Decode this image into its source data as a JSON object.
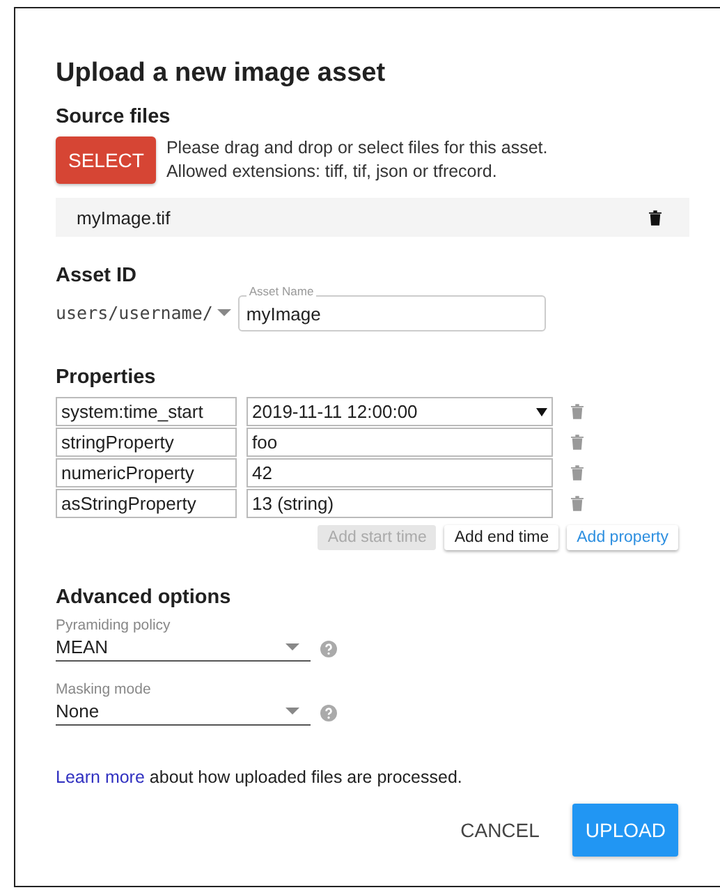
{
  "dialog": {
    "title": "Upload a new image asset"
  },
  "source_files": {
    "heading": "Source files",
    "select_button": "SELECT",
    "hint_lines": [
      "Please drag and drop or select files for this asset.",
      "Allowed extensions: tiff, tif, json or tfrecord."
    ],
    "files": [
      {
        "name": "myImage.tif"
      }
    ]
  },
  "asset_id": {
    "heading": "Asset ID",
    "prefix": "users/username/",
    "name_label": "Asset Name",
    "name_value": "myImage"
  },
  "properties": {
    "heading": "Properties",
    "rows": [
      {
        "key": "system:time_start",
        "value": "2019-11-11 12:00:00",
        "kind": "datetime"
      },
      {
        "key": "stringProperty",
        "value": "foo",
        "kind": "text"
      },
      {
        "key": "numericProperty",
        "value": "42",
        "kind": "text"
      },
      {
        "key": "asStringProperty",
        "value": "13 (string)",
        "kind": "text"
      }
    ],
    "buttons": [
      {
        "label": "Add start time",
        "disabled": true,
        "kind": "plain"
      },
      {
        "label": "Add end time",
        "disabled": false,
        "kind": "plain"
      },
      {
        "label": "Add property",
        "disabled": false,
        "kind": "accent"
      }
    ]
  },
  "advanced": {
    "heading": "Advanced options",
    "selects": [
      {
        "label": "Pyramiding policy",
        "value": "MEAN"
      },
      {
        "label": "Masking mode",
        "value": "None"
      }
    ]
  },
  "footer": {
    "link": "Learn more",
    "text": " about how uploaded files are processed.",
    "buttons": [
      {
        "label": "CANCEL",
        "kind": "flat"
      },
      {
        "label": "UPLOAD",
        "kind": "raised"
      }
    ]
  }
}
